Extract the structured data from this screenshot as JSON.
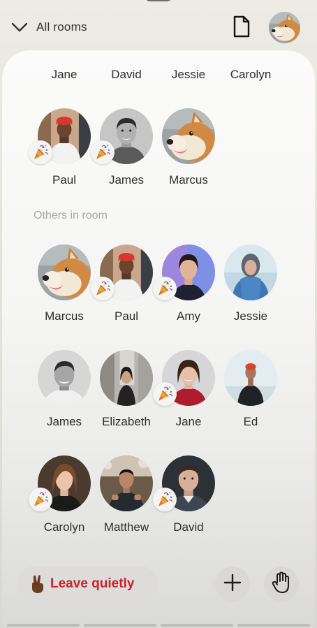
{
  "header": {
    "rooms_label": "All rooms",
    "chevron_icon": "chevron-down-icon",
    "document_icon": "document-icon",
    "profile_avatar": "shiba-avatar"
  },
  "top_row_names": [
    "Jane",
    "David",
    "Jessie",
    "Carolyn"
  ],
  "stage_people": [
    {
      "name": "Paul",
      "celebrating": true
    },
    {
      "name": "James",
      "celebrating": true
    },
    {
      "name": "Marcus",
      "celebrating": false
    }
  ],
  "others_label": "Others in room",
  "others_people": [
    {
      "name": "Marcus",
      "celebrating": false
    },
    {
      "name": "Paul",
      "celebrating": true
    },
    {
      "name": "Amy",
      "celebrating": true
    },
    {
      "name": "Jessie",
      "celebrating": false
    },
    {
      "name": "James",
      "celebrating": false
    },
    {
      "name": "Elizabeth",
      "celebrating": false
    },
    {
      "name": "Jane",
      "celebrating": true
    },
    {
      "name": "Ed",
      "celebrating": false
    },
    {
      "name": "Carolyn",
      "celebrating": true
    },
    {
      "name": "Matthew",
      "celebrating": false
    },
    {
      "name": "David",
      "celebrating": true
    }
  ],
  "badge_icon": "party-popper-icon",
  "footer": {
    "leave_label": "Leave quietly",
    "leave_icon": "victory-hand-icon",
    "add_icon": "plus-icon",
    "raise_hand_icon": "raise-hand-icon"
  },
  "colors": {
    "leave_text": "#c8242b",
    "section_label": "#a7a7a7",
    "card_background": "#f8f8f7"
  }
}
